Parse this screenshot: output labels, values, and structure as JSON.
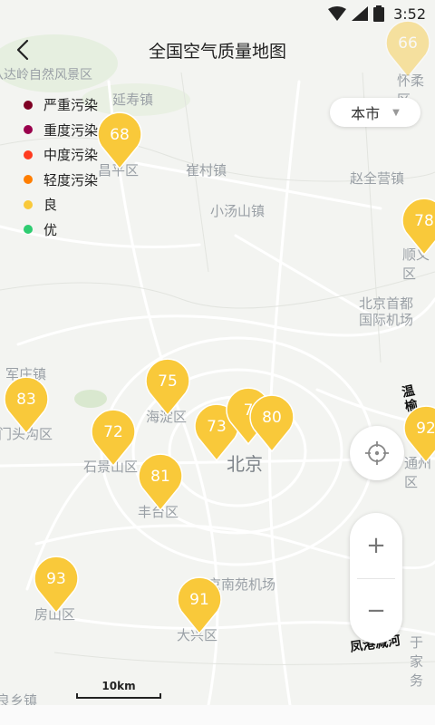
{
  "status_bar": {
    "time": "3:52"
  },
  "header": {
    "title": "全国空气质量地图"
  },
  "legend": [
    {
      "label": "严重污染",
      "color": "#7e0023"
    },
    {
      "label": "重度污染",
      "color": "#99004c"
    },
    {
      "label": "中度污染",
      "color": "#ff3b1f"
    },
    {
      "label": "轻度污染",
      "color": "#ff7e00"
    },
    {
      "label": "良",
      "color": "#f9c93a"
    },
    {
      "label": "优",
      "color": "#2ecc71"
    }
  ],
  "region_select": {
    "value": "本市"
  },
  "map_labels": [
    "八达岭自然风景区",
    "延寿镇",
    "昌平区",
    "崔村镇",
    "赵全营镇",
    "小汤山镇",
    "北京首都国际机场",
    "顺义区",
    "军庄镇",
    "门头沟区",
    "海淀区",
    "石景山区",
    "北京",
    "丰台区",
    "北京南苑机场",
    "房山区",
    "大兴区",
    "通州区",
    "怀柔区",
    "温榆河",
    "凤港减河",
    "于家务",
    "良乡镇"
  ],
  "aqi_markers": [
    {
      "value": "68",
      "faded": false
    },
    {
      "value": "75",
      "faded": false
    },
    {
      "value": "83",
      "faded": false
    },
    {
      "value": "72",
      "faded": false
    },
    {
      "value": "73",
      "faded": false
    },
    {
      "value": "7",
      "faded": false
    },
    {
      "value": "80",
      "faded": false
    },
    {
      "value": "81",
      "faded": false
    },
    {
      "value": "93",
      "faded": false
    },
    {
      "value": "91",
      "faded": false
    },
    {
      "value": "78",
      "faded": false
    },
    {
      "value": "92",
      "faded": false
    },
    {
      "value": "66",
      "faded": true
    }
  ],
  "scale_bar": {
    "label": "10km"
  },
  "zoom": {
    "in": "+",
    "out": "−"
  },
  "icons": {
    "back": "chevron-left-icon",
    "locate": "crosshair-icon",
    "wifi": "wifi-icon",
    "signal": "signal-icon",
    "battery": "battery-icon"
  }
}
